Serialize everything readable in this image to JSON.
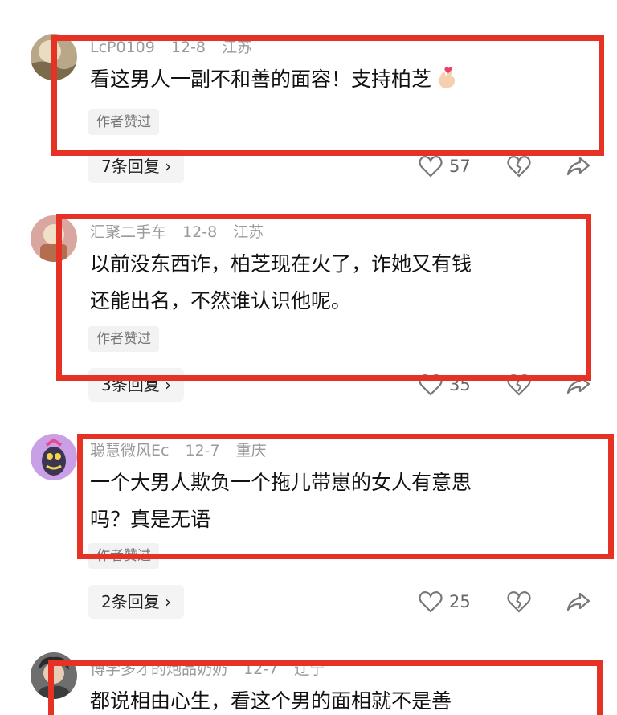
{
  "comments": [
    {
      "username": "LcP0109",
      "date": "12-8",
      "location": "江苏",
      "text": "看这男人一副不和善的面容！支持柏芝",
      "liked_by_author": "作者赞过",
      "replies": "7条回复 ›",
      "likes": "57"
    },
    {
      "username": "汇聚二手车",
      "date": "12-8",
      "location": "江苏",
      "text_lines": [
        "以前没东西诈，柏芝现在火了，诈她又有钱",
        "还能出名，不然谁认识他呢。"
      ],
      "liked_by_author": "作者赞过",
      "replies": "3条回复 ›",
      "likes": "35"
    },
    {
      "username": "聪慧微风Ec",
      "date": "12-7",
      "location": "重庆",
      "text_lines": [
        "一个大男人欺负一个拖儿带崽的女人有意思",
        "吗？真是无语"
      ],
      "liked_by_author": "作者赞过",
      "replies": "2条回复 ›",
      "likes": "25"
    },
    {
      "username": "博学多才的炮品奶奶",
      "date": "12-7",
      "location": "辽宁",
      "text": "都说相由心生，看这个男的面相就不是善"
    }
  ],
  "icons": {
    "like": "heart-outline-icon",
    "dislike": "broken-heart-icon",
    "share": "share-arrow-icon",
    "emoji": "finger-heart-emoji-icon"
  },
  "colors": {
    "highlight_box": "#e53224",
    "meta_text": "#9a9a9a"
  }
}
